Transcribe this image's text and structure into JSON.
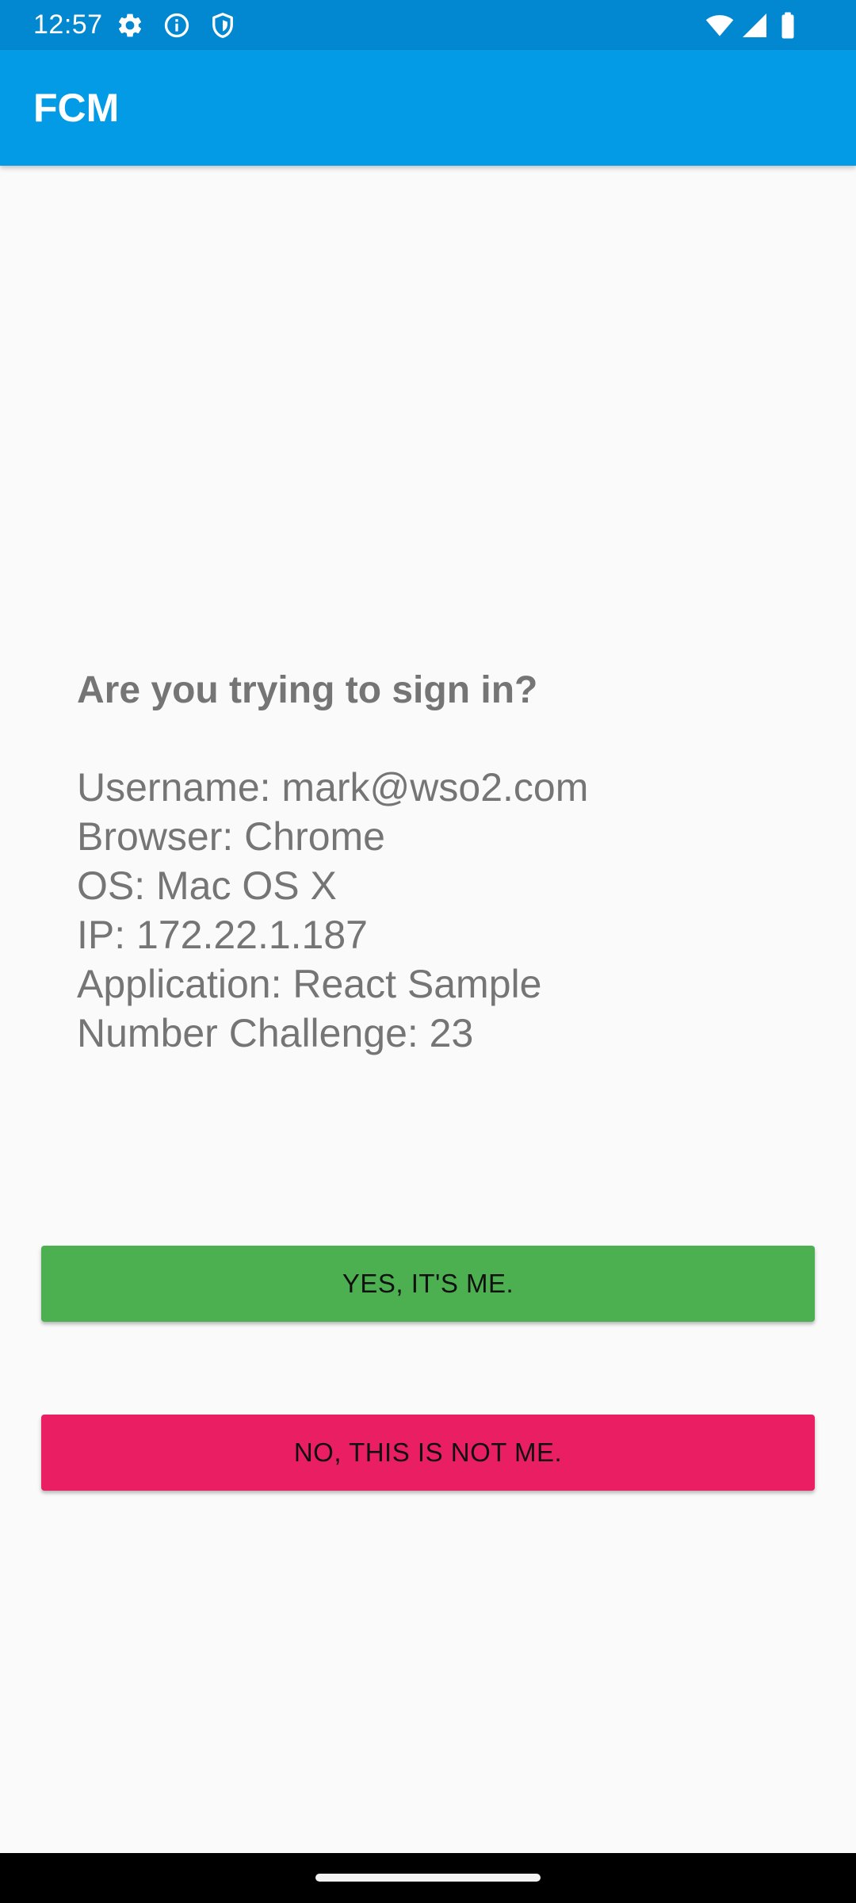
{
  "status_bar": {
    "time": "12:57",
    "left_icons": [
      "gear-icon",
      "info-icon",
      "shield-icon"
    ],
    "right_icons": [
      "wifi-icon",
      "cell-signal-icon",
      "battery-icon"
    ]
  },
  "app_bar": {
    "title": "FCM",
    "color": "#039be5"
  },
  "prompt": {
    "question": "Are you trying to sign in?",
    "details": [
      "Username: mark@wso2.com",
      "Browser: Chrome",
      "OS: Mac OS X",
      "IP: 172.22.1.187",
      "Application: React Sample",
      "Number Challenge: 23"
    ]
  },
  "buttons": {
    "yes_label": "YES, IT'S ME.",
    "yes_color": "#4caf50",
    "no_label": "NO, THIS IS NOT ME.",
    "no_color": "#e91e63"
  }
}
